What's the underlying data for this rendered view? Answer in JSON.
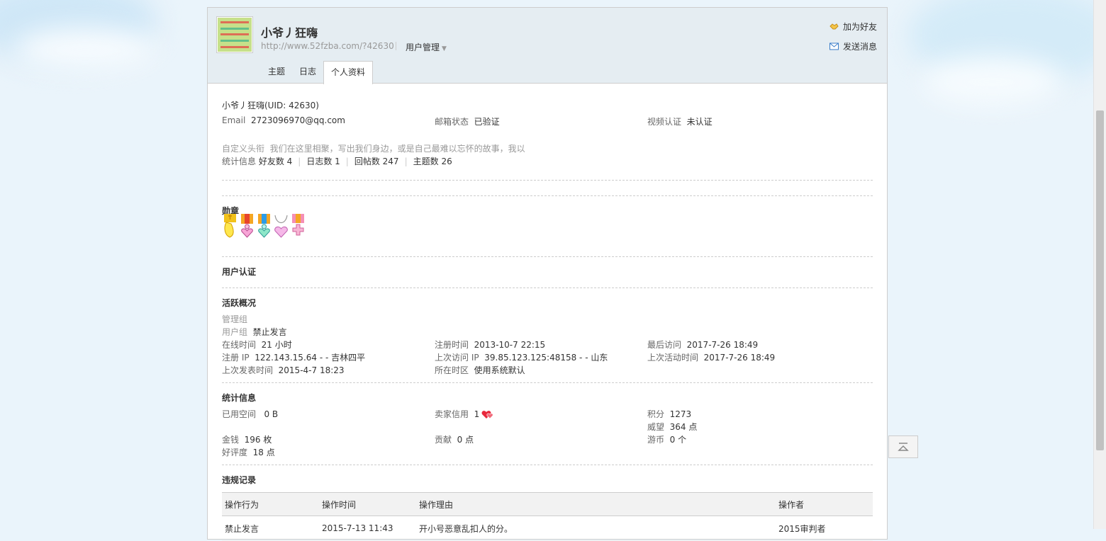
{
  "header": {
    "username": "小爷丿狂嗨",
    "home_url": "http://www.52fzba.com/?42630",
    "user_manage": "用户管理",
    "add_friend": "加为好友",
    "send_message": "发送消息"
  },
  "tabs": [
    {
      "label": "主题"
    },
    {
      "label": "日志"
    },
    {
      "label": "个人资料"
    }
  ],
  "profile": {
    "name_uid": "小爷丿狂嗨(UID: 42630)",
    "email_label": "Email",
    "email_value": "2723096970@qq.com",
    "mail_status_label": "邮箱状态",
    "mail_status_value": "已验证",
    "video_label": "视频认证",
    "video_value": "未认证",
    "custom_title_label": "自定义头衔",
    "custom_title_value": "我们在这里相聚，写出我们身边，或是自己最难以忘怀的故事，我以",
    "stats_label": "统计信息",
    "stats": [
      "好友数 4",
      "日志数 1",
      "回帖数 247",
      "主题数 26"
    ]
  },
  "medals_title": "勋章",
  "medals": [
    {
      "icon": "gold-ribbon-medal-icon"
    },
    {
      "icon": "pink-heart-medal-icon"
    },
    {
      "icon": "cyan-heart-medal-icon"
    },
    {
      "icon": "heart-necklace-medal-icon"
    },
    {
      "icon": "pink-cross-medal-icon"
    }
  ],
  "verify_title": "用户认证",
  "activity": {
    "title": "活跃概况",
    "admin_group_label": "管理组",
    "user_group_label": "用户组",
    "user_group_value": "禁止发言",
    "online_label": "在线时间",
    "online_value": "21 小时",
    "reg_time_label": "注册时间",
    "reg_time_value": "2013-10-7 22:15",
    "last_visit_label": "最后访问",
    "last_visit_value": "2017-7-26 18:49",
    "reg_ip_label": "注册 IP",
    "reg_ip_value": "122.143.15.64 - - 吉林四平",
    "last_ip_label": "上次访问 IP",
    "last_ip_value": "39.85.123.125:48158 - - 山东",
    "last_active_label": "上次活动时间",
    "last_active_value": "2017-7-26 18:49",
    "last_post_label": "上次发表时间",
    "last_post_value": "2015-4-7 18:23",
    "timezone_label": "所在时区",
    "timezone_value": "使用系统默认"
  },
  "statistics": {
    "title": "统计信息",
    "space_label": "已用空间",
    "space_value": "0 B",
    "seller_label": "卖家信用",
    "seller_value": "1",
    "credits_label": "积分",
    "credits_value": "1273",
    "prestige_label": "威望",
    "prestige_value": "364 点",
    "money_label": "金钱",
    "money_value": "196 枚",
    "contrib_label": "贡献",
    "contrib_value": "0 点",
    "coins_label": "游币",
    "coins_value": "0 个",
    "rating_label": "好评度",
    "rating_value": "18 点"
  },
  "violations": {
    "title": "违规记录",
    "columns": [
      "操作行为",
      "操作时间",
      "操作理由",
      "操作者"
    ],
    "rows": [
      [
        "禁止发言",
        "2015-7-13 11:43",
        "开小号恶意乱扣人的分。",
        "2015审判者"
      ]
    ]
  },
  "colors": {
    "header_bg": "#e5edf2",
    "border": "#cdcdcd",
    "label": "#666666"
  }
}
